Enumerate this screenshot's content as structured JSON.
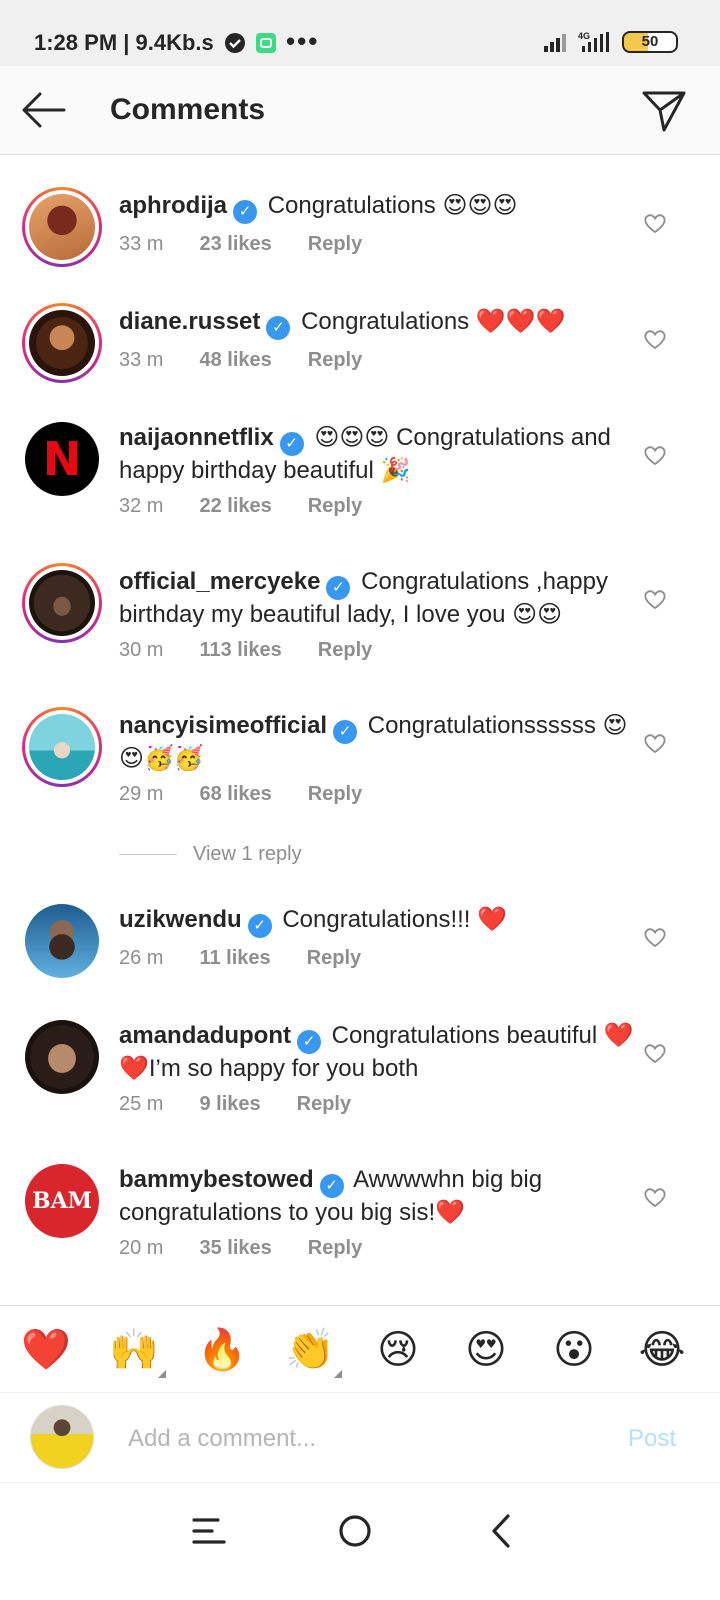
{
  "status_bar": {
    "time_speed": "1:28 PM | 9.4Kb.s",
    "network_label": "4G",
    "more": "•••",
    "battery": "50"
  },
  "header": {
    "title": "Comments"
  },
  "comments": [
    {
      "username": "aphrodija",
      "text": "Congratulations 😍😍😍",
      "time": "33 m",
      "likes": "23 likes",
      "reply": "Reply",
      "avatar_color": "#c0703c"
    },
    {
      "username": "diane.russet",
      "text": "Congratulations ❤️❤️❤️",
      "time": "33 m",
      "likes": "48 likes",
      "reply": "Reply",
      "avatar_color": "#6b3a1f"
    },
    {
      "username": "naijaonnetflix",
      "text": "😍😍😍 Congratulations and happy birthday beautiful 🎉",
      "time": "32 m",
      "likes": "22 likes",
      "reply": "Reply",
      "avatar_letter": "N"
    },
    {
      "username": "official_mercyeke",
      "text": "Congratulations ,happy birthday my beautiful lady, I love you 😍😍",
      "time": "30 m",
      "likes": "113 likes",
      "reply": "Reply",
      "avatar_color": "#4a3426"
    },
    {
      "username": "nancyisimeofficial",
      "text": "Congratulationssssss 😍😍🥳🥳",
      "time": "29 m",
      "likes": "68 likes",
      "reply": "Reply",
      "avatar_color": "#3fb6c4"
    },
    {
      "username": "uzikwendu",
      "text": "Congratulations!!! ❤️",
      "time": "26 m",
      "likes": "11 likes",
      "reply": "Reply",
      "avatar_color": "#2b7bb8"
    },
    {
      "username": "amandadupont",
      "text": "Congratulations beautiful ❤️❤️I’m so happy for you both",
      "time": "25 m",
      "likes": "9 likes",
      "reply": "Reply",
      "avatar_color": "#3a2a22"
    },
    {
      "username": "bammybestowed",
      "text": "Awwwwhn big big congratulations to you big sis!❤️",
      "time": "20 m",
      "likes": "35 likes",
      "reply": "Reply",
      "avatar_letter": "BAM"
    }
  ],
  "view_replies": "View 1 reply",
  "reactions": [
    "❤️",
    "🙌",
    "🔥",
    "👏",
    "😢",
    "😍",
    "😮",
    "😂"
  ],
  "input": {
    "placeholder": "Add a comment...",
    "post_label": "Post"
  },
  "colors": {
    "verified": "#3897f0",
    "meta_text": "#8e8e8e",
    "post_disabled": "#b2dffc"
  }
}
